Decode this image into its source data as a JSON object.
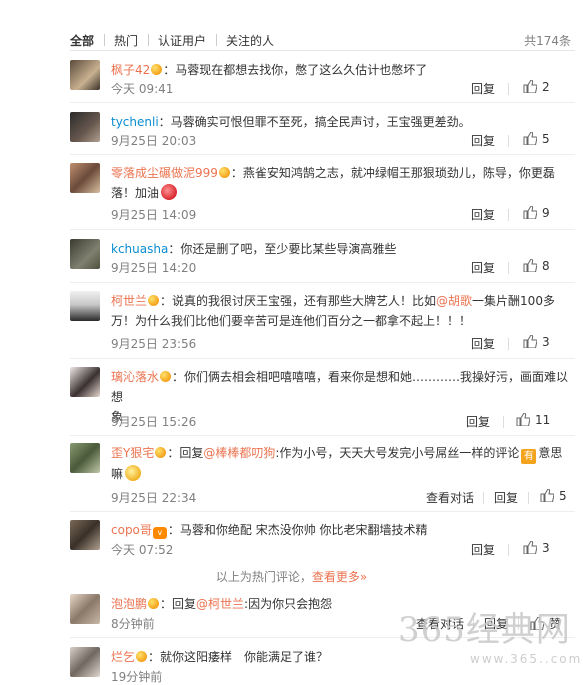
{
  "tabs": [
    "全部",
    "热门",
    "认证用户",
    "关注的人"
  ],
  "total": "共174条",
  "actions": {
    "reply": "回复",
    "view_convo": "查看对话"
  },
  "comments": [
    {
      "user": "枫子42",
      "text": "：马蓉现在都想去找你，憋了这么久估计也憋坏了",
      "time": "今天 09:41",
      "likes": "2"
    },
    {
      "user": "tychenli",
      "text": "：马蓉确实可恨但罪不至死，搞全民声讨，王宝强更差劲。",
      "time": "9月25日 20:03",
      "likes": "5"
    },
    {
      "user": "零落成尘碾做泥999",
      "text1": "：燕雀安知鸿鹄之志，就冲绿帽王那狠琐劲儿，陈导，你更磊",
      "text2": "落！加油",
      "time": "9月25日 14:09",
      "likes": "9"
    },
    {
      "user": "kchuasha",
      "text": "：你还是删了吧，至少要比某些导演高雅些",
      "time": "9月25日 14:20",
      "likes": "8"
    },
    {
      "user": "柯世兰",
      "text1": "：说真的我很讨厌王宝强，还有那些大牌艺人！比如",
      "mention": "@胡歌",
      "text2": "一集片酬100多",
      "text3": "万！为什么我们比他们要辛苦可是连他们百分之一都拿不起上！！！",
      "time": "9月25日 23:56",
      "likes": "3"
    },
    {
      "user": "璃沁落水",
      "text1": "：你们俩去相会相吧嘻嘻嘻，看来你是想和她…………我操好污，画面难以想",
      "text2": "象",
      "time": "9月25日 15:26",
      "likes": "11"
    },
    {
      "user": "歪Y狠宅",
      "reply": "：回复",
      "mention": "@棒棒都叨狗",
      "text1": ":作为小号，天天大号发完小号屌丝一样的评论",
      "emo_label": "有",
      "text2": "意思",
      "text3": "嘛",
      "time": "9月25日 22:34",
      "likes": "5"
    },
    {
      "user": "copo哥",
      "text": "：马蓉和你绝配 宋杰没你帅 你比老宋翻墙技术精",
      "time": "今天 07:52",
      "likes": "3"
    },
    {
      "user": "泡泡鹏",
      "reply": "：回复",
      "mention": "@柯世兰",
      "text": ":因为你只会抱怨",
      "time": "8分钟前",
      "likes": "赞"
    },
    {
      "user": "烂乞",
      "text": "：就你这阳痿样　你能满足了谁？",
      "time": "19分钟前",
      "likes": ""
    }
  ],
  "hot_note": {
    "prefix": "以上为热门评论，",
    "link": "查看更多»"
  },
  "watermark": {
    "big": "365经典网",
    "small": "www.365..com"
  },
  "colors": {
    "username": "#eb7350",
    "username_blue": "#0a8cd2",
    "meta": "#808080"
  }
}
